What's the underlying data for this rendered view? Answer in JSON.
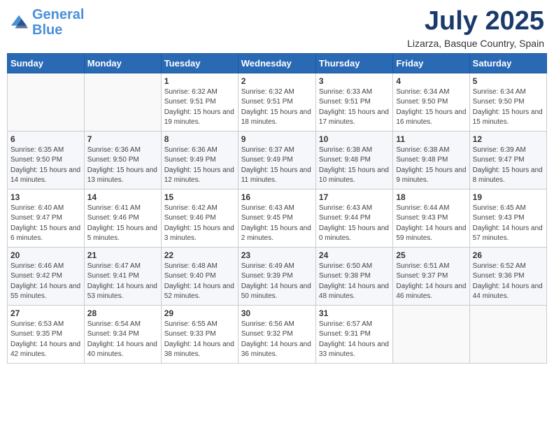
{
  "header": {
    "logo_line1": "General",
    "logo_line2": "Blue",
    "month": "July 2025",
    "location": "Lizarza, Basque Country, Spain"
  },
  "weekdays": [
    "Sunday",
    "Monday",
    "Tuesday",
    "Wednesday",
    "Thursday",
    "Friday",
    "Saturday"
  ],
  "weeks": [
    [
      {
        "num": "",
        "info": ""
      },
      {
        "num": "",
        "info": ""
      },
      {
        "num": "1",
        "info": "Sunrise: 6:32 AM\nSunset: 9:51 PM\nDaylight: 15 hours and 19 minutes."
      },
      {
        "num": "2",
        "info": "Sunrise: 6:32 AM\nSunset: 9:51 PM\nDaylight: 15 hours and 18 minutes."
      },
      {
        "num": "3",
        "info": "Sunrise: 6:33 AM\nSunset: 9:51 PM\nDaylight: 15 hours and 17 minutes."
      },
      {
        "num": "4",
        "info": "Sunrise: 6:34 AM\nSunset: 9:50 PM\nDaylight: 15 hours and 16 minutes."
      },
      {
        "num": "5",
        "info": "Sunrise: 6:34 AM\nSunset: 9:50 PM\nDaylight: 15 hours and 15 minutes."
      }
    ],
    [
      {
        "num": "6",
        "info": "Sunrise: 6:35 AM\nSunset: 9:50 PM\nDaylight: 15 hours and 14 minutes."
      },
      {
        "num": "7",
        "info": "Sunrise: 6:36 AM\nSunset: 9:50 PM\nDaylight: 15 hours and 13 minutes."
      },
      {
        "num": "8",
        "info": "Sunrise: 6:36 AM\nSunset: 9:49 PM\nDaylight: 15 hours and 12 minutes."
      },
      {
        "num": "9",
        "info": "Sunrise: 6:37 AM\nSunset: 9:49 PM\nDaylight: 15 hours and 11 minutes."
      },
      {
        "num": "10",
        "info": "Sunrise: 6:38 AM\nSunset: 9:48 PM\nDaylight: 15 hours and 10 minutes."
      },
      {
        "num": "11",
        "info": "Sunrise: 6:38 AM\nSunset: 9:48 PM\nDaylight: 15 hours and 9 minutes."
      },
      {
        "num": "12",
        "info": "Sunrise: 6:39 AM\nSunset: 9:47 PM\nDaylight: 15 hours and 8 minutes."
      }
    ],
    [
      {
        "num": "13",
        "info": "Sunrise: 6:40 AM\nSunset: 9:47 PM\nDaylight: 15 hours and 6 minutes."
      },
      {
        "num": "14",
        "info": "Sunrise: 6:41 AM\nSunset: 9:46 PM\nDaylight: 15 hours and 5 minutes."
      },
      {
        "num": "15",
        "info": "Sunrise: 6:42 AM\nSunset: 9:46 PM\nDaylight: 15 hours and 3 minutes."
      },
      {
        "num": "16",
        "info": "Sunrise: 6:43 AM\nSunset: 9:45 PM\nDaylight: 15 hours and 2 minutes."
      },
      {
        "num": "17",
        "info": "Sunrise: 6:43 AM\nSunset: 9:44 PM\nDaylight: 15 hours and 0 minutes."
      },
      {
        "num": "18",
        "info": "Sunrise: 6:44 AM\nSunset: 9:43 PM\nDaylight: 14 hours and 59 minutes."
      },
      {
        "num": "19",
        "info": "Sunrise: 6:45 AM\nSunset: 9:43 PM\nDaylight: 14 hours and 57 minutes."
      }
    ],
    [
      {
        "num": "20",
        "info": "Sunrise: 6:46 AM\nSunset: 9:42 PM\nDaylight: 14 hours and 55 minutes."
      },
      {
        "num": "21",
        "info": "Sunrise: 6:47 AM\nSunset: 9:41 PM\nDaylight: 14 hours and 53 minutes."
      },
      {
        "num": "22",
        "info": "Sunrise: 6:48 AM\nSunset: 9:40 PM\nDaylight: 14 hours and 52 minutes."
      },
      {
        "num": "23",
        "info": "Sunrise: 6:49 AM\nSunset: 9:39 PM\nDaylight: 14 hours and 50 minutes."
      },
      {
        "num": "24",
        "info": "Sunrise: 6:50 AM\nSunset: 9:38 PM\nDaylight: 14 hours and 48 minutes."
      },
      {
        "num": "25",
        "info": "Sunrise: 6:51 AM\nSunset: 9:37 PM\nDaylight: 14 hours and 46 minutes."
      },
      {
        "num": "26",
        "info": "Sunrise: 6:52 AM\nSunset: 9:36 PM\nDaylight: 14 hours and 44 minutes."
      }
    ],
    [
      {
        "num": "27",
        "info": "Sunrise: 6:53 AM\nSunset: 9:35 PM\nDaylight: 14 hours and 42 minutes."
      },
      {
        "num": "28",
        "info": "Sunrise: 6:54 AM\nSunset: 9:34 PM\nDaylight: 14 hours and 40 minutes."
      },
      {
        "num": "29",
        "info": "Sunrise: 6:55 AM\nSunset: 9:33 PM\nDaylight: 14 hours and 38 minutes."
      },
      {
        "num": "30",
        "info": "Sunrise: 6:56 AM\nSunset: 9:32 PM\nDaylight: 14 hours and 36 minutes."
      },
      {
        "num": "31",
        "info": "Sunrise: 6:57 AM\nSunset: 9:31 PM\nDaylight: 14 hours and 33 minutes."
      },
      {
        "num": "",
        "info": ""
      },
      {
        "num": "",
        "info": ""
      }
    ]
  ]
}
